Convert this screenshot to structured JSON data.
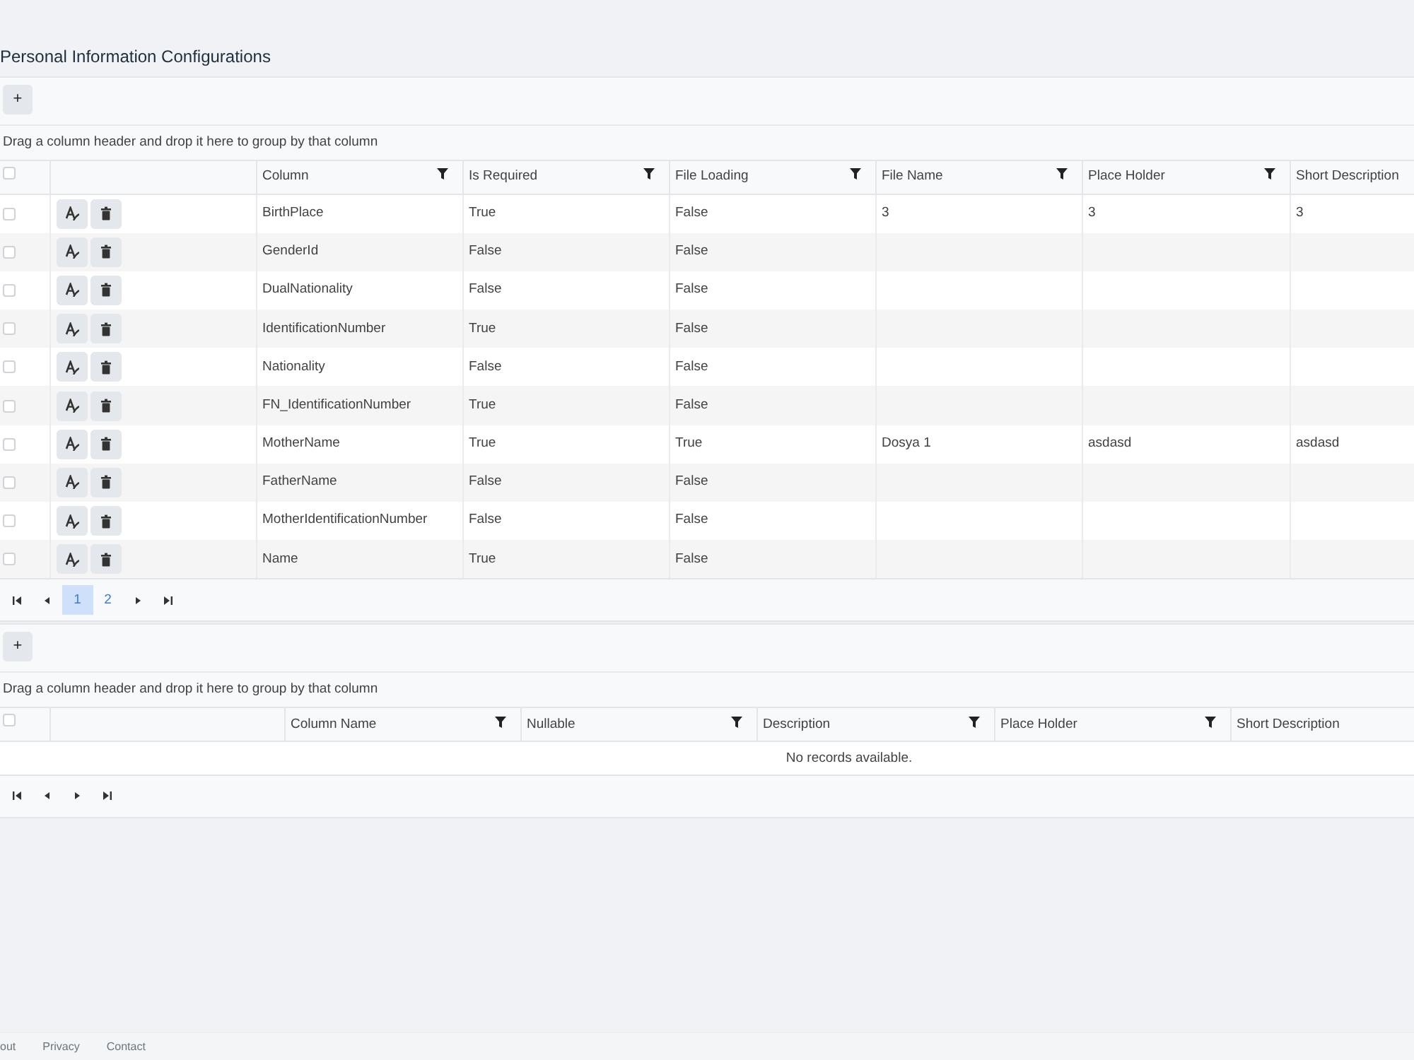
{
  "page": {
    "title": "Personal Information Configurations"
  },
  "fields_grid": {
    "add_button": "+",
    "group_hint": "Drag a column header and drop it here to group by that column",
    "select_all": {
      "checked": false
    },
    "columns": [
      {
        "label": "Column",
        "filterable": true
      },
      {
        "label": "Is Required",
        "filterable": true
      },
      {
        "label": "File Loading",
        "filterable": true
      },
      {
        "label": "File Name",
        "filterable": true
      },
      {
        "label": "Place Holder",
        "filterable": true
      },
      {
        "label": "Short Description",
        "filterable": false
      }
    ],
    "rows": [
      {
        "checked": false,
        "column": "BirthPlace",
        "is_required": "True",
        "file_loading": "False",
        "file_name": "3",
        "place_holder": "3",
        "short_description": "3"
      },
      {
        "checked": false,
        "column": "GenderId",
        "is_required": "False",
        "file_loading": "False"
      },
      {
        "checked": false,
        "column": "DualNationality",
        "is_required": "False",
        "file_loading": "False"
      },
      {
        "checked": false,
        "column": "IdentificationNumber",
        "is_required": "True",
        "file_loading": "False"
      },
      {
        "checked": false,
        "column": "Nationality",
        "is_required": "False",
        "file_loading": "False"
      },
      {
        "checked": false,
        "column": "FN_IdentificationNumber",
        "is_required": "True",
        "file_loading": "False"
      },
      {
        "checked": false,
        "column": "MotherName",
        "is_required": "True",
        "file_loading": "True",
        "file_name": "Dosya 1",
        "place_holder": "asdasd",
        "short_description": "asdasd"
      },
      {
        "checked": false,
        "column": "FatherName",
        "is_required": "False",
        "file_loading": "False"
      },
      {
        "checked": false,
        "column": "MotherIdentificationNumber",
        "is_required": "False",
        "file_loading": "False"
      },
      {
        "checked": false,
        "column": "Name",
        "is_required": "True",
        "file_loading": "False"
      }
    ],
    "pager": {
      "pages": [
        {
          "label": "1",
          "selected": true
        },
        {
          "label": "2",
          "selected": false
        }
      ]
    }
  },
  "details_grid": {
    "add_button": "+",
    "group_hint": "Drag a column header and drop it here to group by that column",
    "select_all": {
      "checked": false
    },
    "columns": [
      {
        "label": "Column Name",
        "filterable": true
      },
      {
        "label": "Nullable",
        "filterable": true
      },
      {
        "label": "Description",
        "filterable": true
      },
      {
        "label": "Place Holder",
        "filterable": true
      },
      {
        "label": "Short Description",
        "filterable": false
      }
    ],
    "empty_message": "No records available."
  },
  "footer": {
    "links": [
      "out",
      "Privacy",
      "Contact"
    ]
  }
}
